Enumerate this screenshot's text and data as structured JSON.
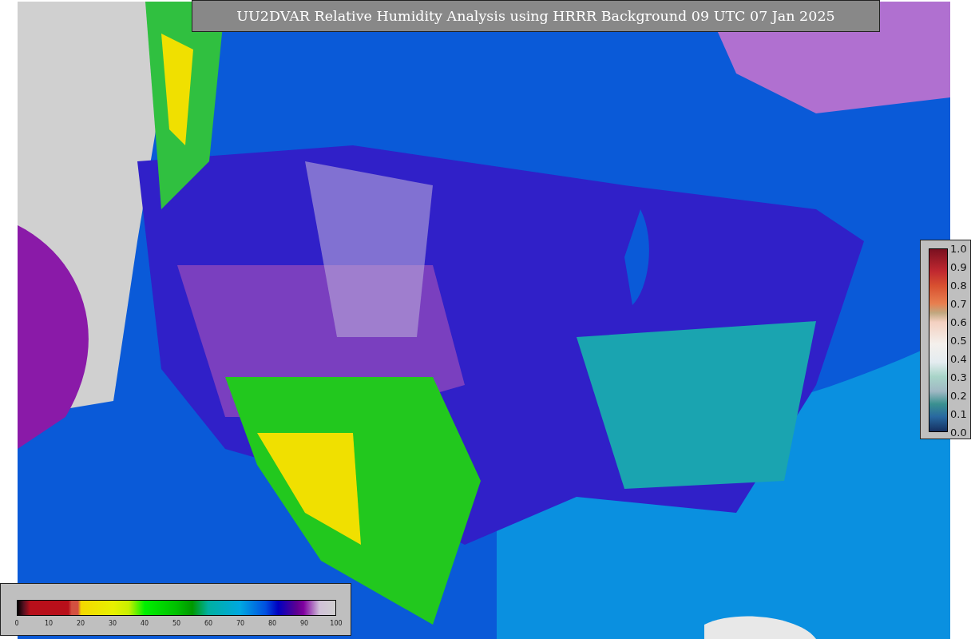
{
  "title": "UU2DVAR Relative Humidity Analysis using HRRR Background 09 UTC 07 Jan 2025",
  "humidity_colorbar": {
    "ticks": [
      "0",
      "10",
      "20",
      "30",
      "40",
      "50",
      "60",
      "70",
      "80",
      "90",
      "100"
    ]
  },
  "fraction_colorbar": {
    "ticks": [
      "1.0",
      "0.9",
      "0.8",
      "0.7",
      "0.6",
      "0.5",
      "0.4",
      "0.3",
      "0.2",
      "0.1",
      "0.0"
    ]
  }
}
